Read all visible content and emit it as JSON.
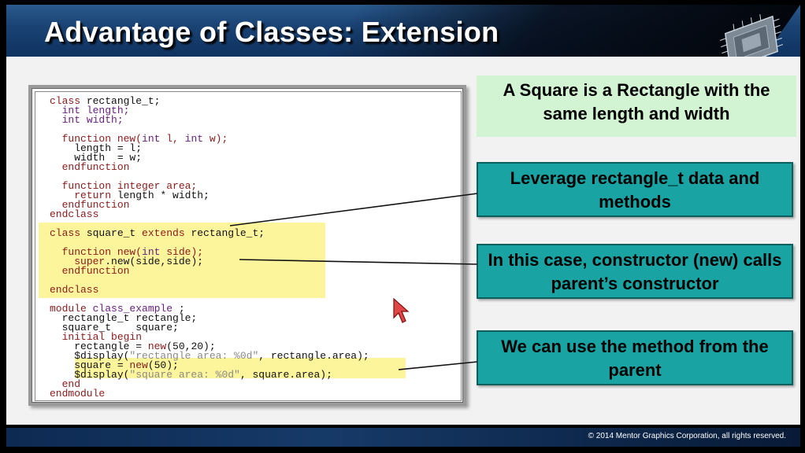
{
  "slide": {
    "title": "Advantage of Classes: Extension",
    "footer": "© 2014 Mentor Graphics Corporation, all rights reserved."
  },
  "code": {
    "lines": [
      [
        [
          "kw",
          "class "
        ],
        [
          "nm",
          "rectangle_t;"
        ]
      ],
      [
        [
          "nm",
          "  "
        ],
        [
          "ty",
          "int length;"
        ]
      ],
      [
        [
          "nm",
          "  "
        ],
        [
          "ty",
          "int width;"
        ]
      ],
      [
        [
          "nm",
          ""
        ]
      ],
      [
        [
          "nm",
          "  "
        ],
        [
          "kw",
          "function new("
        ],
        [
          "ty",
          "int "
        ],
        [
          "kw",
          "l, "
        ],
        [
          "ty",
          "int "
        ],
        [
          "kw",
          "w);"
        ]
      ],
      [
        [
          "nm",
          "    length = l;"
        ]
      ],
      [
        [
          "nm",
          "    width  = w;"
        ]
      ],
      [
        [
          "nm",
          "  "
        ],
        [
          "kw",
          "endfunction"
        ]
      ],
      [
        [
          "nm",
          ""
        ]
      ],
      [
        [
          "nm",
          "  "
        ],
        [
          "kw",
          "function integer area;"
        ]
      ],
      [
        [
          "nm",
          "    "
        ],
        [
          "kw",
          "return "
        ],
        [
          "nm",
          "length * width;"
        ]
      ],
      [
        [
          "nm",
          "  "
        ],
        [
          "kw",
          "endfunction"
        ]
      ],
      [
        [
          "kw",
          "endclass"
        ]
      ],
      [
        [
          "nm",
          ""
        ]
      ],
      [
        [
          "kw",
          "class "
        ],
        [
          "nm",
          "square_t "
        ],
        [
          "kw",
          "extends "
        ],
        [
          "nm",
          "rectangle_t;"
        ]
      ],
      [
        [
          "nm",
          ""
        ]
      ],
      [
        [
          "nm",
          "  "
        ],
        [
          "kw",
          "function new("
        ],
        [
          "ty",
          "int "
        ],
        [
          "kw",
          "side);"
        ]
      ],
      [
        [
          "nm",
          "    "
        ],
        [
          "kw",
          "super"
        ],
        [
          "nm",
          ".new(side,side);"
        ]
      ],
      [
        [
          "nm",
          "  "
        ],
        [
          "kw",
          "endfunction"
        ]
      ],
      [
        [
          "nm",
          ""
        ]
      ],
      [
        [
          "kw",
          "endclass"
        ]
      ],
      [
        [
          "nm",
          ""
        ]
      ],
      [
        [
          "kw",
          "module "
        ],
        [
          "ty",
          "class_example "
        ],
        [
          "nm",
          ";"
        ]
      ],
      [
        [
          "nm",
          "  rectangle_t rectangle;"
        ]
      ],
      [
        [
          "nm",
          "  square_t    square;"
        ]
      ],
      [
        [
          "nm",
          "  "
        ],
        [
          "kw",
          "initial begin"
        ]
      ],
      [
        [
          "nm",
          "    rectangle = "
        ],
        [
          "kw",
          "new"
        ],
        [
          "nm",
          "(50,20);"
        ]
      ],
      [
        [
          "nm",
          "    $display("
        ],
        [
          "str",
          "\"rectangle area: %0d\""
        ],
        [
          "nm",
          ", rectangle.area);"
        ]
      ],
      [
        [
          "nm",
          "    square = "
        ],
        [
          "kw",
          "new"
        ],
        [
          "nm",
          "(50);"
        ]
      ],
      [
        [
          "nm",
          "    $display("
        ],
        [
          "str",
          "\"square area: %0d\""
        ],
        [
          "nm",
          ", square.area);"
        ]
      ],
      [
        [
          "nm",
          "  "
        ],
        [
          "kw",
          "end"
        ]
      ],
      [
        [
          "kw",
          "endmodule"
        ]
      ]
    ]
  },
  "callouts": {
    "square_note": "A Square is a Rectangle with the same length and width",
    "leverage": "Leverage rectangle_t data and methods",
    "constructor": "In this case, constructor (new) calls parent’s constructor",
    "method": "We can use the method from the parent"
  },
  "colors": {
    "keyword": "#8b1a1a",
    "type": "#6a2080",
    "string": "#8a8a8a",
    "highlight": "#fdf59c",
    "callout_teal": "#19a3a3",
    "callout_green": "#d2f4d2"
  },
  "icons": {
    "cursor": "mouse-pointer-icon",
    "logo": "microchip-graphic"
  }
}
